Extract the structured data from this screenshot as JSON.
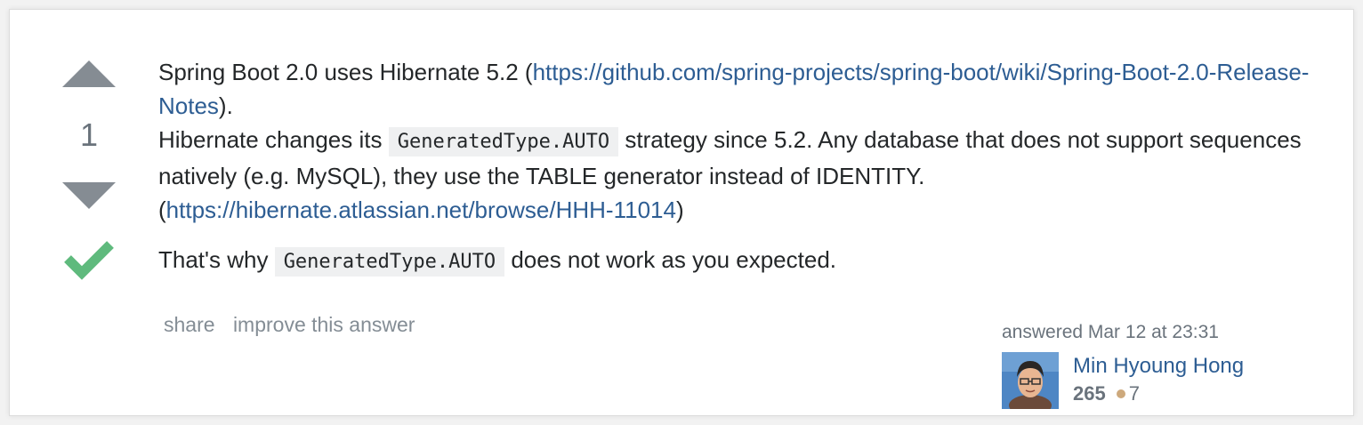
{
  "answer": {
    "vote_count": "1",
    "p1": {
      "t1": "Spring Boot 2.0 uses Hibernate 5.2 (",
      "link1": "https://github.com/spring-projects/spring-boot/wiki/Spring-Boot-2.0-Release-Notes",
      "t2": ").",
      "t3": "Hibernate changes its ",
      "code1": "GeneratedType.AUTO",
      "t4": " strategy since 5.2. Any database that does not support sequences natively (e.g. MySQL), they use the TABLE generator instead of IDENTITY. (",
      "link2": "https://hibernate.atlassian.net/browse/HHH-11014",
      "t5": ")"
    },
    "p2": {
      "t1": "That's why ",
      "code1": "GeneratedType.AUTO",
      "t2": " does not work as you expected."
    },
    "actions": {
      "share": "share",
      "improve": "improve this answer"
    },
    "signature": {
      "answered": "answered Mar 12 at 23:31",
      "user_name": "Min Hyoung Hong",
      "reputation": "265",
      "bronze_badges": "7"
    }
  },
  "colors": {
    "link": "#2d5d93",
    "vote_arrow": "#858c93",
    "accepted": "#5fba7d",
    "bronze": "#cda97c"
  },
  "icons": [
    "upvote-arrow-icon",
    "downvote-arrow-icon",
    "accepted-check-icon",
    "bronze-badge-icon"
  ]
}
